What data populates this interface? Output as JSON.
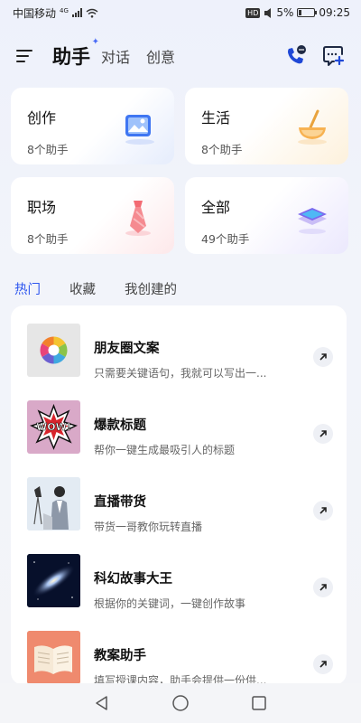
{
  "status_bar": {
    "carrier": "中国移动",
    "network": "4G",
    "hd": "HD",
    "battery": "5%",
    "time": "09:25"
  },
  "header": {
    "tabs": [
      {
        "label": "助手",
        "active": true
      },
      {
        "label": "对话",
        "active": false
      },
      {
        "label": "创意",
        "active": false
      }
    ]
  },
  "categories": [
    {
      "title": "创作",
      "count": "8个助手"
    },
    {
      "title": "生活",
      "count": "8个助手"
    },
    {
      "title": "职场",
      "count": "8个助手"
    },
    {
      "title": "全部",
      "count": "49个助手"
    }
  ],
  "filters": [
    {
      "label": "热门",
      "active": true
    },
    {
      "label": "收藏",
      "active": false
    },
    {
      "label": "我创建的",
      "active": false
    }
  ],
  "assistants": [
    {
      "name": "朋友圈文案",
      "desc": "只需要关键语句，我就可以写出一..."
    },
    {
      "name": "爆款标题",
      "desc": "帮你一键生成最吸引人的标题"
    },
    {
      "name": "直播带货",
      "desc": "带货一哥教你玩转直播"
    },
    {
      "name": "科幻故事大王",
      "desc": "根据你的关键词，一键创作故事"
    },
    {
      "name": "教案助手",
      "desc": "填写授课内容，助手会提供一份供..."
    }
  ],
  "thumb_text": "WOW!",
  "accent_color": "#2f57ef"
}
